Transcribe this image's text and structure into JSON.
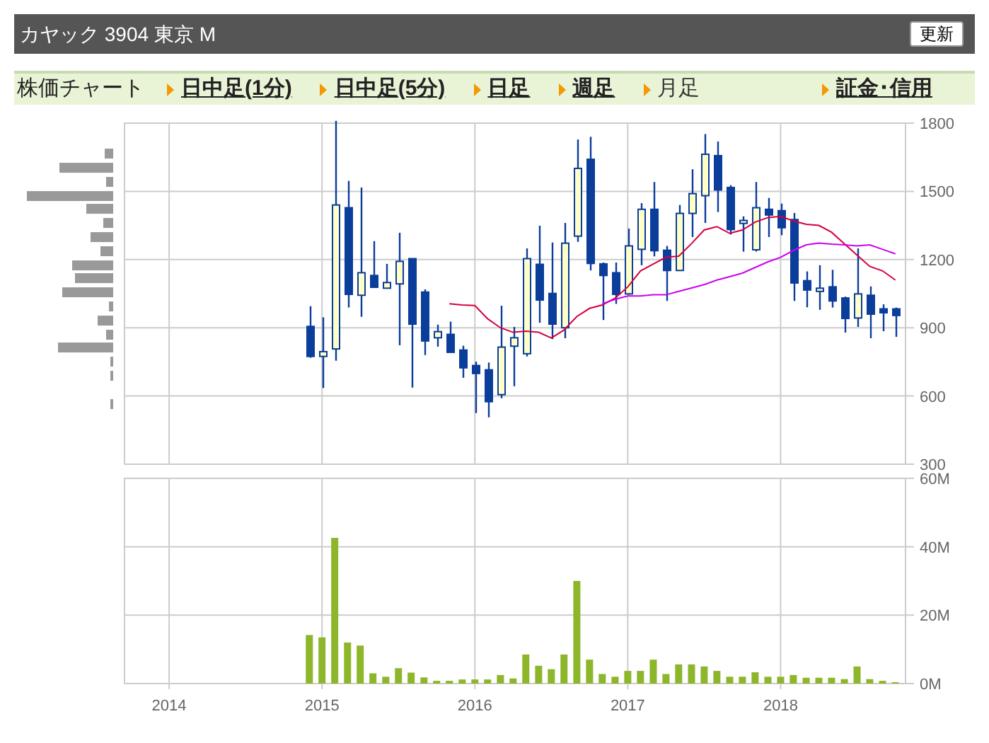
{
  "header": {
    "title": "カヤック 3904 東京 M",
    "refresh_button": "更新"
  },
  "nav": {
    "section_title": "株価チャート",
    "tabs": [
      {
        "label": "日中足(1分)",
        "selected": false
      },
      {
        "label": "日中足(5分)",
        "selected": false
      },
      {
        "label": "日足",
        "selected": false
      },
      {
        "label": "週足",
        "selected": false
      },
      {
        "label": "月足",
        "selected": true
      }
    ],
    "link": "証金･信用"
  },
  "price_chart": {
    "chart_data": {
      "type": "candlestick",
      "grid": true,
      "x": [
        2014.917,
        2015,
        2015.083,
        2015.167,
        2015.25,
        2015.333,
        2015.417,
        2015.5,
        2015.583,
        2015.667,
        2015.75,
        2015.833,
        2015.917,
        2016,
        2016.083,
        2016.167,
        2016.25,
        2016.333,
        2016.417,
        2016.5,
        2016.583,
        2016.667,
        2016.75,
        2016.833,
        2016.917,
        2017,
        2017.083,
        2017.167,
        2017.25,
        2017.333,
        2017.417,
        2017.5,
        2017.583,
        2017.667,
        2017.75,
        2017.833,
        2017.917,
        2018,
        2018.083,
        2018.167,
        2018.25,
        2018.333,
        2018.417,
        2018.5,
        2018.583,
        2018.667,
        2018.75
      ],
      "xlim": [
        2013.708,
        2018.817
      ],
      "ylim": [
        300,
        1800
      ],
      "yticks": [
        {
          "value": 300,
          "label": "300"
        },
        {
          "value": 600,
          "label": "600"
        },
        {
          "value": 900,
          "label": "900"
        },
        {
          "value": 1200,
          "label": "1200"
        },
        {
          "value": 1500,
          "label": "1500"
        },
        {
          "value": 1800,
          "label": "1800"
        }
      ],
      "series": [
        {
          "type": "line",
          "color": "#d4003c",
          "values": [
            null,
            null,
            null,
            null,
            null,
            null,
            null,
            null,
            null,
            null,
            null,
            1006,
            1000,
            998,
            940,
            900,
            880,
            885,
            880,
            855,
            890,
            950,
            985,
            1000,
            1030,
            1080,
            1150,
            1180,
            1210,
            1215,
            1270,
            1330,
            1345,
            1315,
            1330,
            1365,
            1385,
            1390,
            1370,
            1355,
            1350,
            1320,
            1270,
            1220,
            1170,
            1150,
            1110
          ]
        },
        {
          "type": "line",
          "color": "#cc00ee",
          "values": [
            null,
            null,
            null,
            null,
            null,
            null,
            null,
            null,
            null,
            null,
            null,
            null,
            null,
            null,
            null,
            null,
            null,
            null,
            null,
            null,
            null,
            null,
            null,
            1005,
            1025,
            1040,
            1040,
            1045,
            1045,
            1060,
            1075,
            1090,
            1110,
            1125,
            1140,
            1165,
            1190,
            1210,
            1240,
            1265,
            1272,
            1268,
            1265,
            1260,
            1265,
            1245,
            1225
          ]
        }
      ],
      "ohlc": [
        [
          906,
          995,
          768,
          774
        ],
        [
          774,
          946,
          635,
          795
        ],
        [
          807,
          1810,
          755,
          1440
        ],
        [
          1428,
          1546,
          989,
          1047
        ],
        [
          1043,
          1517,
          948,
          1142
        ],
        [
          1130,
          1281,
          1078,
          1078
        ],
        [
          1074,
          1181,
          1074,
          1099
        ],
        [
          1093,
          1318,
          823,
          1192
        ],
        [
          1204,
          1204,
          637,
          916
        ],
        [
          1057,
          1069,
          780,
          842
        ],
        [
          856,
          914,
          817,
          883
        ],
        [
          871,
          927,
          792,
          792
        ],
        [
          802,
          821,
          680,
          724
        ],
        [
          734,
          751,
          525,
          699
        ],
        [
          715,
          747,
          506,
          575
        ],
        [
          606,
          997,
          590,
          815
        ],
        [
          819,
          904,
          643,
          856
        ],
        [
          786,
          1249,
          774,
          1204
        ],
        [
          1179,
          1349,
          922,
          1022
        ],
        [
          1051,
          1275,
          850,
          916
        ],
        [
          900,
          1361,
          854,
          1272
        ],
        [
          1303,
          1728,
          1278,
          1601
        ],
        [
          1641,
          1740,
          1152,
          1183
        ],
        [
          1181,
          1187,
          934,
          1130
        ],
        [
          1142,
          1187,
          1005,
          1047
        ],
        [
          1049,
          1336,
          1045,
          1260
        ],
        [
          1245,
          1448,
          1175,
          1421
        ],
        [
          1421,
          1541,
          1214,
          1239
        ],
        [
          1241,
          1260,
          1018,
          1152
        ],
        [
          1152,
          1440,
          1152,
          1403
        ],
        [
          1403,
          1597,
          1299,
          1490
        ],
        [
          1481,
          1752,
          1361,
          1663
        ],
        [
          1657,
          1719,
          1409,
          1506
        ],
        [
          1517,
          1527,
          1310,
          1332
        ],
        [
          1359,
          1390,
          1235,
          1372
        ],
        [
          1243,
          1541,
          1235,
          1428
        ],
        [
          1421,
          1471,
          1299,
          1396
        ],
        [
          1415,
          1446,
          1307,
          1340
        ],
        [
          1376,
          1405,
          1018,
          1097
        ],
        [
          1107,
          1148,
          990,
          1066
        ],
        [
          1060,
          1175,
          979,
          1074
        ],
        [
          1080,
          1155,
          989,
          1018
        ],
        [
          1031,
          1037,
          879,
          941
        ],
        [
          943,
          1249,
          904,
          1049
        ],
        [
          1043,
          1082,
          854,
          960
        ],
        [
          983,
          1003,
          885,
          966
        ],
        [
          983,
          989,
          860,
          954
        ]
      ]
    }
  },
  "volume_chart": {
    "chart_data": {
      "type": "bar",
      "grid": true,
      "x": [
        2014.917,
        2015,
        2015.083,
        2015.167,
        2015.25,
        2015.333,
        2015.417,
        2015.5,
        2015.583,
        2015.667,
        2015.75,
        2015.833,
        2015.917,
        2016,
        2016.083,
        2016.167,
        2016.25,
        2016.333,
        2016.417,
        2016.5,
        2016.583,
        2016.667,
        2016.75,
        2016.833,
        2016.917,
        2017,
        2017.083,
        2017.167,
        2017.25,
        2017.333,
        2017.417,
        2017.5,
        2017.583,
        2017.667,
        2017.75,
        2017.833,
        2017.917,
        2018,
        2018.083,
        2018.167,
        2018.25,
        2018.333,
        2018.417,
        2018.5,
        2018.583,
        2018.667,
        2018.75
      ],
      "xlim": [
        2013.708,
        2018.817
      ],
      "ylim": [
        0,
        60
      ],
      "yticks": [
        {
          "value": 0,
          "label": "0M"
        },
        {
          "value": 20,
          "label": "20M"
        },
        {
          "value": 40,
          "label": "40M"
        },
        {
          "value": 60,
          "label": "60M"
        }
      ],
      "xticks": [
        2014,
        2015,
        2016,
        2017,
        2018
      ],
      "series": [
        {
          "color": "#8db62b",
          "values": [
            14.2,
            13.5,
            42.6,
            12,
            11.1,
            3,
            2,
            4.5,
            3.2,
            1.8,
            0.8,
            0.8,
            1.2,
            1.2,
            1.2,
            2.5,
            1.5,
            8.5,
            5.2,
            4.2,
            8.5,
            30,
            7,
            2.8,
            2,
            3.7,
            3.7,
            7,
            2.8,
            5.6,
            5.6,
            5,
            3.7,
            2,
            2,
            3.3,
            2,
            2,
            2.5,
            1.7,
            1.7,
            1.7,
            1.3,
            5,
            1.3,
            0.8,
            0.4
          ]
        }
      ]
    }
  }
}
